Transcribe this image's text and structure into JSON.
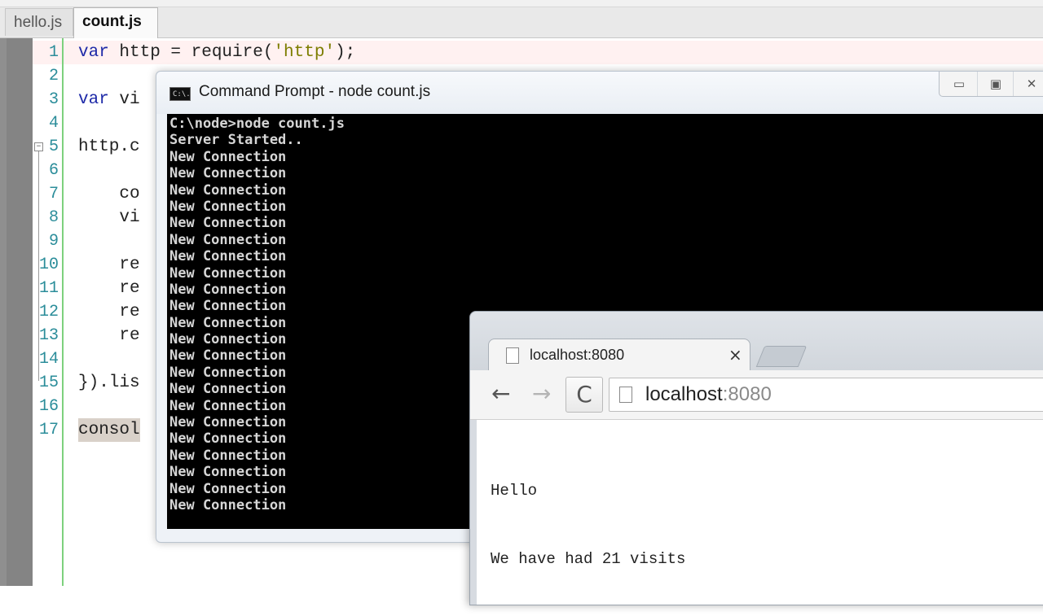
{
  "editor": {
    "tabs": [
      {
        "label": "hello.js"
      },
      {
        "label": "count.js"
      }
    ],
    "lines": [
      {
        "num": "1",
        "text": "var http = require('http');"
      },
      {
        "num": "2",
        "text": ""
      },
      {
        "num": "3",
        "text": "var vi"
      },
      {
        "num": "4",
        "text": ""
      },
      {
        "num": "5",
        "text": "http.c"
      },
      {
        "num": "6",
        "text": ""
      },
      {
        "num": "7",
        "text": "    co"
      },
      {
        "num": "8",
        "text": "    vi"
      },
      {
        "num": "9",
        "text": ""
      },
      {
        "num": "10",
        "text": "    re"
      },
      {
        "num": "11",
        "text": "    re"
      },
      {
        "num": "12",
        "text": "    re"
      },
      {
        "num": "13",
        "text": "    re"
      },
      {
        "num": "14",
        "text": ""
      },
      {
        "num": "15",
        "text": "}).lis"
      },
      {
        "num": "16",
        "text": ""
      },
      {
        "num": "17",
        "text": "consol"
      }
    ]
  },
  "cmd": {
    "title": "Command Prompt - node  count.js",
    "icon_label": "C:\\.",
    "lines": [
      "C:\\node>node count.js",
      "Server Started..",
      "New Connection",
      "New Connection",
      "New Connection",
      "New Connection",
      "New Connection",
      "New Connection",
      "New Connection",
      "New Connection",
      "New Connection",
      "New Connection",
      "New Connection",
      "New Connection",
      "New Connection",
      "New Connection",
      "New Connection",
      "New Connection",
      "New Connection",
      "New Connection",
      "New Connection",
      "New Connection",
      "New Connection",
      "New Connection"
    ],
    "buttons": {
      "minimize": "▭",
      "maximize": "▣",
      "close": "✕"
    }
  },
  "browser": {
    "tab_title": "localhost:8080",
    "tab_close": "×",
    "nav": {
      "back": "←",
      "forward": "→",
      "reload": "C"
    },
    "address": {
      "host": "localhost",
      "port": ":8080"
    },
    "page": {
      "line1": "Hello",
      "line2": "We have had 21 visits"
    }
  },
  "colors": {
    "keyword": "#1e2aa8",
    "string": "#7d7d00",
    "line_number": "#2b8d9a",
    "terminal_bg": "#000000",
    "terminal_fg": "#d6d6d6"
  }
}
